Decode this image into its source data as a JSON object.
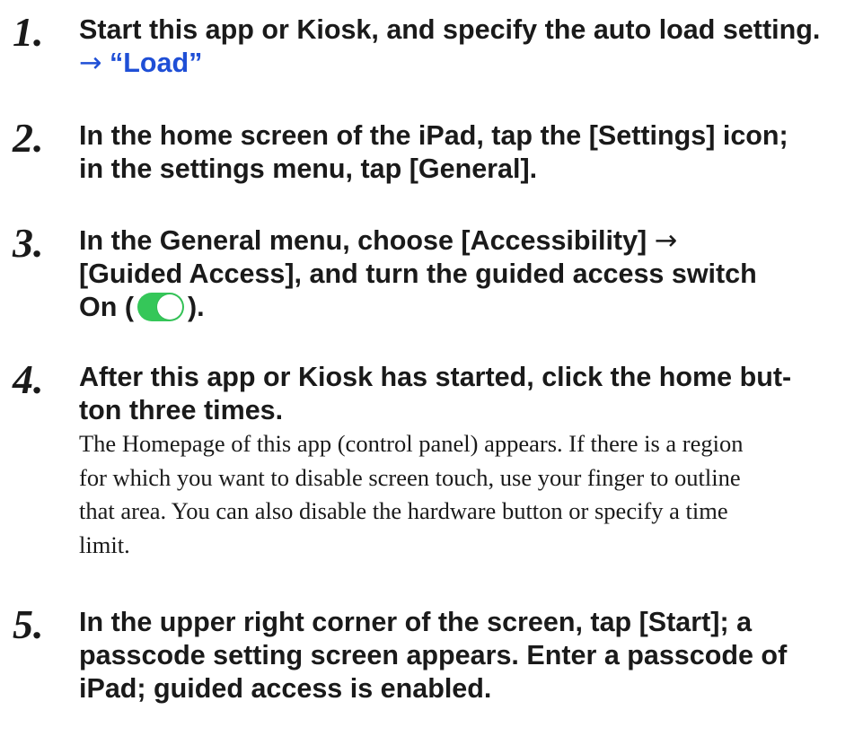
{
  "steps": [
    {
      "number": "1.",
      "lines": [
        "Start this app or Kiosk, and specify the auto load setting."
      ],
      "link_arrow": "→",
      "link_text": "“Load”"
    },
    {
      "number": "2.",
      "lines": [
        "In the home screen of the iPad, tap the [Settings] icon;",
        "in the settings menu, tap [General]."
      ]
    },
    {
      "number": "3.",
      "line1_text": "In the General menu, choose [Accessibility] ",
      "line1_arrow": "→",
      "line2": "[Guided Access], and turn the guided access switch",
      "line3_before": "On (",
      "line3_after": ").",
      "switch_state": "on",
      "switch_color": "#35c759"
    },
    {
      "number": "4.",
      "lines": [
        "After this app or Kiosk has started, click the home but-",
        "ton three times."
      ],
      "description": [
        "The Homepage of this app (control panel) appears. If there is a region",
        "for which you want to disable screen touch, use your finger to outline",
        "that area. You can also disable the hardware button or specify a time",
        "limit."
      ]
    },
    {
      "number": "5.",
      "lines": [
        "In the upper right corner of the screen, tap [Start]; a",
        "passcode setting screen appears. Enter a passcode of",
        "iPad; guided access is enabled."
      ]
    }
  ],
  "colors": {
    "text": "#1a1a1a",
    "link": "#1f4fd6",
    "switch_on": "#35c759"
  }
}
